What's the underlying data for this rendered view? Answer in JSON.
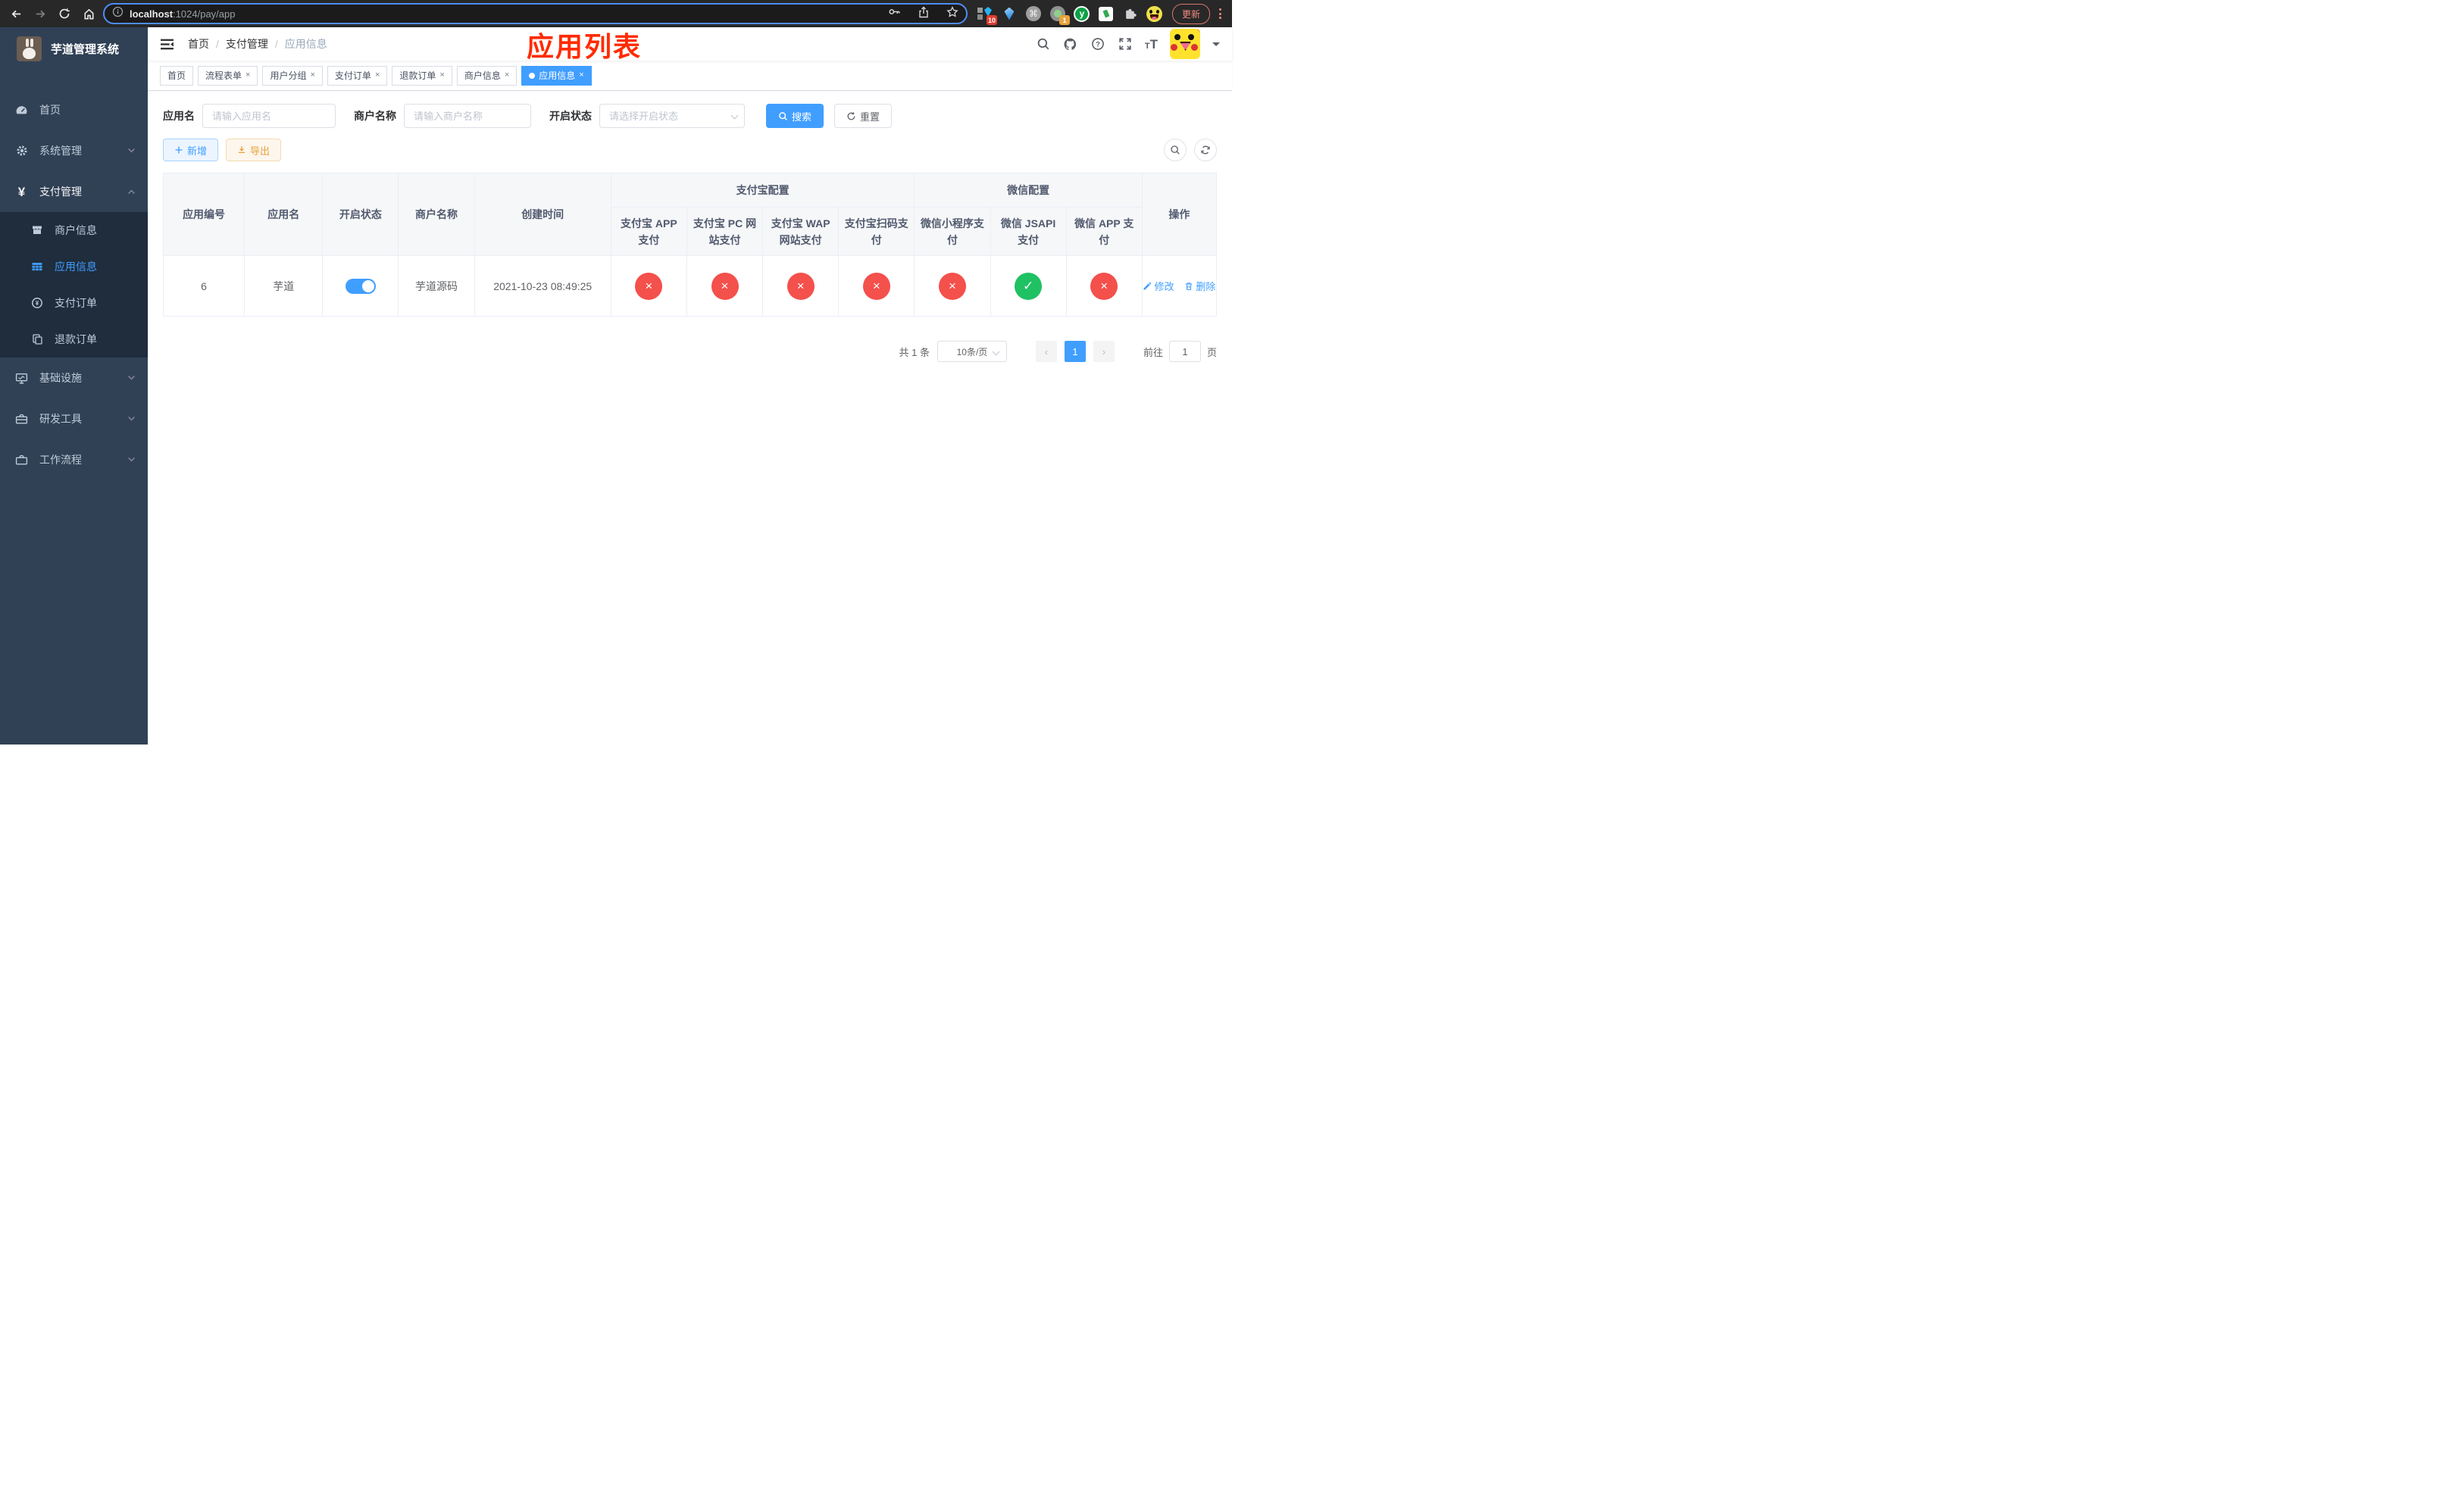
{
  "glyphs": {
    "yen": "¥",
    "question": "?",
    "cmd": "⌘",
    "prev": "‹",
    "next": "›",
    "font_small": "T",
    "font_large": "T"
  },
  "browser": {
    "url_host": "localhost",
    "url_rest": ":1024/pay/app",
    "ext_badge_blocks": "10",
    "ext_badge_cam": "1",
    "ext_y_label": "y",
    "update_label": "更新"
  },
  "sidebar": {
    "title": "芋道管理系统",
    "items": [
      {
        "label": "首页"
      },
      {
        "label": "系统管理"
      },
      {
        "label": "支付管理"
      },
      {
        "label": "商户信息"
      },
      {
        "label": "应用信息"
      },
      {
        "label": "支付订单"
      },
      {
        "label": "退款订单"
      },
      {
        "label": "基础设施"
      },
      {
        "label": "研发工具"
      },
      {
        "label": "工作流程"
      }
    ]
  },
  "header": {
    "breadcrumb": {
      "home": "首页",
      "section": "支付管理",
      "current": "应用信息"
    },
    "annotation": "应用列表"
  },
  "tabs": [
    {
      "label": "首页"
    },
    {
      "label": "流程表单"
    },
    {
      "label": "用户分组"
    },
    {
      "label": "支付订单"
    },
    {
      "label": "退款订单"
    },
    {
      "label": "商户信息"
    },
    {
      "label": "应用信息"
    }
  ],
  "filters": {
    "app_name_label": "应用名",
    "app_name_placeholder": "请输入应用名",
    "merchant_label": "商户名称",
    "merchant_placeholder": "请输入商户名称",
    "status_label": "开启状态",
    "status_placeholder": "请选择开启状态",
    "search_label": "搜索",
    "reset_label": "重置"
  },
  "toolbar": {
    "add_label": "新增",
    "export_label": "导出"
  },
  "table": {
    "headers": {
      "id": "应用编号",
      "name": "应用名",
      "enabled": "开启状态",
      "merchant": "商户名称",
      "created": "创建时间",
      "alipay_group": "支付宝配置",
      "wechat_group": "微信配置",
      "alipay_app": "支付宝 APP 支付",
      "alipay_pc": "支付宝 PC 网站支付",
      "alipay_wap": "支付宝 WAP 网站支付",
      "alipay_qr": "支付宝扫码支付",
      "wx_lite": "微信小程序支付",
      "wx_jsapi": "微信 JSAPI 支付",
      "wx_app": "微信 APP 支付",
      "ops": "操作"
    },
    "rows": [
      {
        "id": "6",
        "name": "芋道",
        "merchant": "芋道源码",
        "created": "2021-10-23 08:49:25",
        "channels": {
          "alipay_app": "disabled",
          "alipay_pc": "disabled",
          "alipay_wap": "disabled",
          "alipay_qr": "disabled",
          "wx_lite": "disabled",
          "wx_jsapi": "enabled",
          "wx_app": "disabled"
        },
        "edit_label": "修改",
        "delete_label": "删除"
      }
    ]
  },
  "pagination": {
    "total": "共 1 条",
    "page_size": "10条/页",
    "current_page": "1",
    "goto_label": "前往",
    "goto_value": "1",
    "page_unit": "页"
  },
  "colors": {
    "primary": "#409eff",
    "success": "#1fc163",
    "danger": "#f4504c",
    "warning": "#e6a23c",
    "annotation": "#ff2b00",
    "sidebar_bg": "#304156",
    "submenu_bg": "#1f2d3d"
  }
}
